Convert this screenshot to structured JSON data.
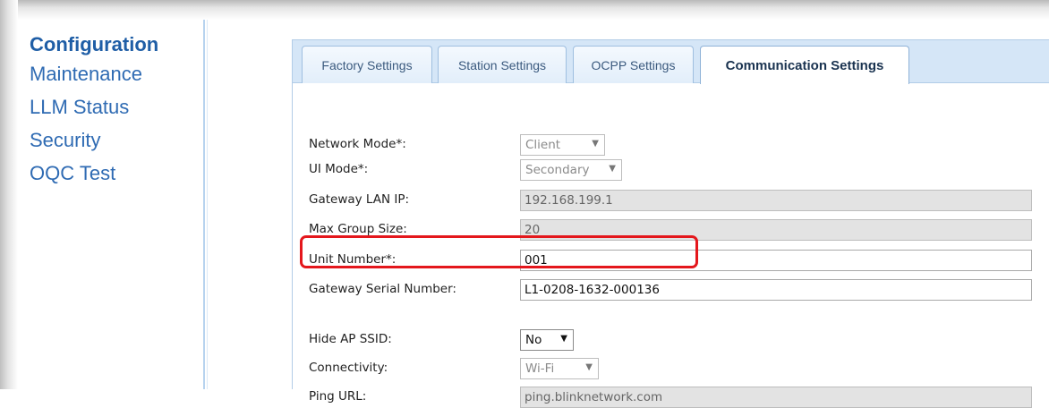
{
  "sidebar": {
    "items": [
      {
        "label": "Configuration",
        "active": true
      },
      {
        "label": "Maintenance"
      },
      {
        "label": "LLM Status"
      },
      {
        "label": "Security"
      },
      {
        "label": "OQC Test"
      }
    ]
  },
  "tabs": [
    {
      "label": "Factory Settings"
    },
    {
      "label": "Station Settings"
    },
    {
      "label": "OCPP Settings"
    },
    {
      "label": "Communication Settings",
      "active": true
    }
  ],
  "form": {
    "network_mode": {
      "label": "Network Mode*:",
      "value": "Client"
    },
    "ui_mode": {
      "label": "UI Mode*:",
      "value": "Secondary"
    },
    "gateway_lan_ip": {
      "label": "Gateway LAN IP:",
      "value": "192.168.199.1"
    },
    "max_group_size": {
      "label": "Max Group Size:",
      "value": "20"
    },
    "unit_number": {
      "label": "Unit Number*:",
      "value": "001"
    },
    "gateway_serial": {
      "label": "Gateway Serial Number:",
      "value": "L1-0208-1632-000136"
    },
    "hide_ap_ssid": {
      "label": "Hide AP SSID:",
      "value": "No"
    },
    "connectivity": {
      "label": "Connectivity:",
      "value": "Wi-Fi"
    },
    "ping_url": {
      "label": "Ping URL:",
      "value": "ping.blinknetwork.com"
    }
  },
  "colors": {
    "highlight": "#e4171c",
    "link": "#2f6bb3",
    "tab_bg": "#d5e6f7"
  }
}
